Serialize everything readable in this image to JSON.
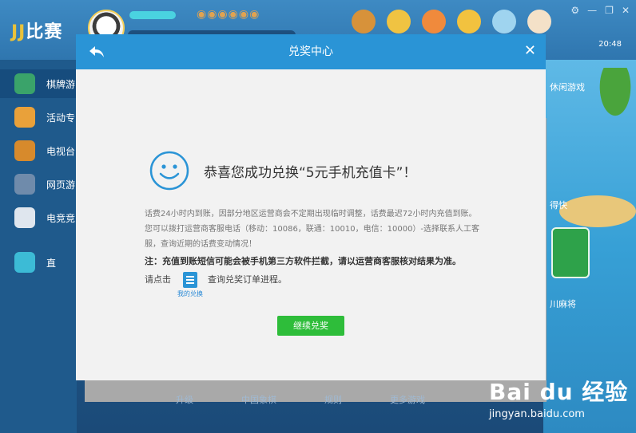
{
  "app": {
    "logo_text": "比赛",
    "logo_prefix": "JJ",
    "clock": "20:48",
    "coins_text": "◉◉◉◉◉◉",
    "window_controls": [
      "⚙",
      "—",
      "❐",
      "✕"
    ]
  },
  "sidebar": {
    "items": [
      {
        "label": "棋牌游",
        "icon": "spade-icon",
        "color": "#3aa36a"
      },
      {
        "label": "活动专",
        "icon": "gift-icon",
        "color": "#e9a13a"
      },
      {
        "label": "电视台",
        "icon": "tv-icon",
        "color": "#d78a2c"
      },
      {
        "label": "网页游",
        "icon": "shield-icon",
        "color": "#6f8bab"
      },
      {
        "label": "电竞竞",
        "icon": "gamepad-icon",
        "color": "#dfe6ee"
      },
      {
        "label": "直",
        "icon": "live-tv-icon",
        "color": "#3cbbd6"
      }
    ]
  },
  "scene": {
    "label_top": "休闲游戏",
    "label_mid": "得快",
    "label_bottom": "川麻将"
  },
  "background_tabs": [
    "升级",
    "中国象棋",
    "规则",
    "更多游戏"
  ],
  "dialog": {
    "title": "兑奖中心",
    "headline": "恭喜您成功兑换“5元手机充值卡”！",
    "note_line1": "话费24小时内到账，因部分地区运营商会不定期出现临时调整，话费最迟72小时内充值到账。",
    "note_line2": "您可以拨打运营商客服电话（移动：10086，联通：10010，电信：10000）-选择联系人工客",
    "note_line3": "服，查询近期的话费变动情况！",
    "note_strong": "注：充值到账短信可能会被手机第三方软件拦截，请以运营商客服核对结果为准。",
    "query_prefix": "请点击",
    "my_exchange_label": "我的兑换",
    "query_suffix": "查询兑奖订单进程。",
    "continue_button": "继续兑奖"
  },
  "watermark": {
    "logo": "Bai du 经验",
    "url": "jingyan.baidu.com"
  },
  "colors": {
    "dialog_header": "#2a94d6",
    "continue_button": "#2ebd3a",
    "dialog_body": "#f2f2f2"
  }
}
